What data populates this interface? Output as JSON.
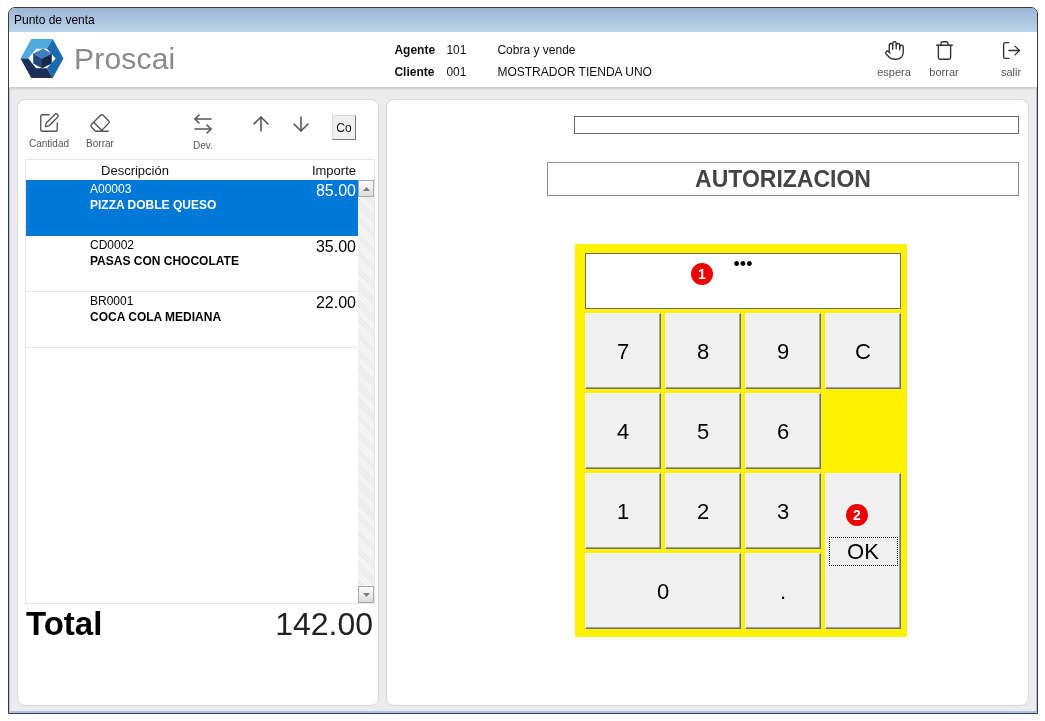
{
  "window": {
    "title": "Punto de venta"
  },
  "header": {
    "brand": "Proscai",
    "info": [
      {
        "label": "Agente",
        "code": "101",
        "value": "Cobra y vende"
      },
      {
        "label": "Cliente",
        "code": "001",
        "value": "MOSTRADOR TIENDA UNO"
      }
    ],
    "actions": [
      {
        "label": "espera"
      },
      {
        "label": "borrar"
      },
      {
        "label": "salir"
      }
    ]
  },
  "order_panel": {
    "tools": [
      {
        "label": "Cantidad"
      },
      {
        "label": "Borrar"
      },
      {
        "label": "Dev."
      }
    ],
    "tool_button": "Co",
    "table": {
      "columns": [
        "Descripción",
        "Importe"
      ],
      "rows": [
        {
          "code": "A00003",
          "name": "PIZZA DOBLE QUESO",
          "amount": "85.00",
          "selected": true
        },
        {
          "code": "CD0002",
          "name": "PASAS CON CHOCOLATE",
          "amount": "35.00",
          "selected": false
        },
        {
          "code": "BR0001",
          "name": "COCA COLA MEDIANA",
          "amount": "22.00",
          "selected": false
        }
      ]
    },
    "total": {
      "label": "Total",
      "amount": "142.00"
    }
  },
  "auth_panel": {
    "title": "AUTORIZACION",
    "keypad": {
      "display": {
        "value": "•••",
        "marker": "1"
      },
      "keys": [
        {
          "label": "7",
          "focused": false
        },
        {
          "label": "8",
          "focused": false
        },
        {
          "label": "9",
          "focused": false
        },
        {
          "label": "C",
          "focused": false
        },
        {
          "label": "4",
          "focused": false
        },
        {
          "label": "5",
          "focused": false
        },
        {
          "label": "6",
          "focused": false
        },
        {
          "label": "1",
          "focused": false
        },
        {
          "label": "2",
          "focused": false
        },
        {
          "label": "3",
          "focused": false
        },
        {
          "label": "OK",
          "focused": true,
          "marker": "2"
        },
        {
          "label": "0",
          "focused": false
        },
        {
          "label": ".",
          "focused": false
        }
      ]
    }
  }
}
